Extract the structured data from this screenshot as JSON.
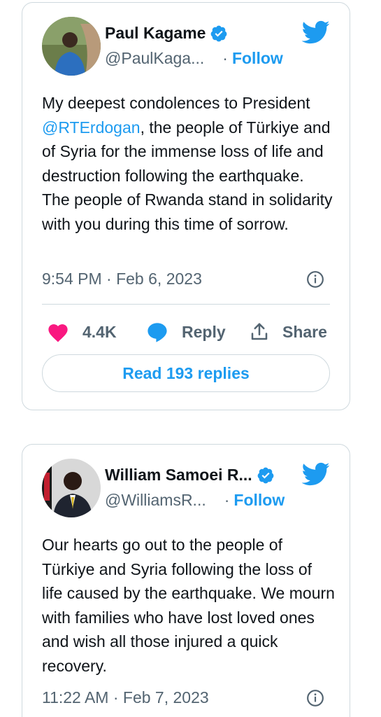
{
  "tweets": [
    {
      "name": "Paul Kagame",
      "handle": "@PaulKaga...",
      "separator": "·",
      "follow_label": "Follow",
      "text_before": "My deepest condolences to President ",
      "mention": "@RTErdogan",
      "text_after": ", the people of Türkiye and of Syria for the immense loss of life and destruction following the earthquake. The people of Rwanda stand in solidarity with you during this time of sorrow.",
      "timestamp": "9:54 PM · Feb 6, 2023",
      "likes": "4.4K",
      "reply_label": "Reply",
      "share_label": "Share",
      "read_replies_label": "Read 193 replies",
      "avatar_icon": "avatar-photo",
      "verified_icon": "verified-badge-icon"
    },
    {
      "name": "William Samoei R...",
      "handle": "@WilliamsR...",
      "separator": "·",
      "follow_label": "Follow",
      "text": "Our hearts go out to the people of Türkiye and Syria following the loss of life caused by the earthquake. We mourn with families who have lost loved ones and wish all those injured a quick recovery.",
      "timestamp": "11:22 AM · Feb 7, 2023",
      "avatar_icon": "avatar-photo",
      "verified_icon": "verified-badge-icon"
    }
  ],
  "colors": {
    "accent": "#1d9bf0",
    "like": "#f91880",
    "muted": "#536471",
    "border": "#cfd9de"
  }
}
